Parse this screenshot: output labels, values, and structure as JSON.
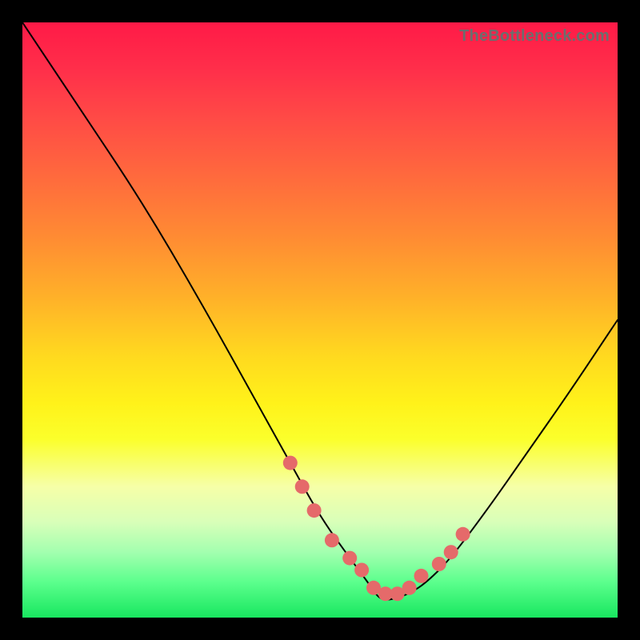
{
  "watermark": "TheBottleneck.com",
  "chart_data": {
    "type": "line",
    "title": "",
    "xlabel": "",
    "ylabel": "",
    "xlim": [
      0,
      100
    ],
    "ylim": [
      0,
      100
    ],
    "grid": false,
    "legend": false,
    "series": [
      {
        "name": "bottleneck-curve",
        "x": [
          0,
          10,
          20,
          30,
          40,
          45,
          50,
          55,
          58,
          60,
          62,
          65,
          68,
          72,
          78,
          85,
          92,
          100
        ],
        "values": [
          100,
          85,
          70,
          53,
          35,
          26,
          17,
          10,
          6,
          3,
          3,
          4,
          6,
          10,
          18,
          28,
          38,
          50
        ]
      }
    ],
    "markers": {
      "name": "highlight-dots",
      "color": "#e56a6a",
      "x": [
        45,
        47,
        49,
        52,
        55,
        57,
        59,
        61,
        63,
        65,
        67,
        70,
        72,
        74
      ],
      "values": [
        26,
        22,
        18,
        13,
        10,
        8,
        5,
        4,
        4,
        5,
        7,
        9,
        11,
        14
      ]
    }
  },
  "colors": {
    "curve": "#000000",
    "marker": "#e56a6a",
    "background_top": "#ff1a47",
    "background_bottom": "#18e75f",
    "frame": "#000000"
  }
}
